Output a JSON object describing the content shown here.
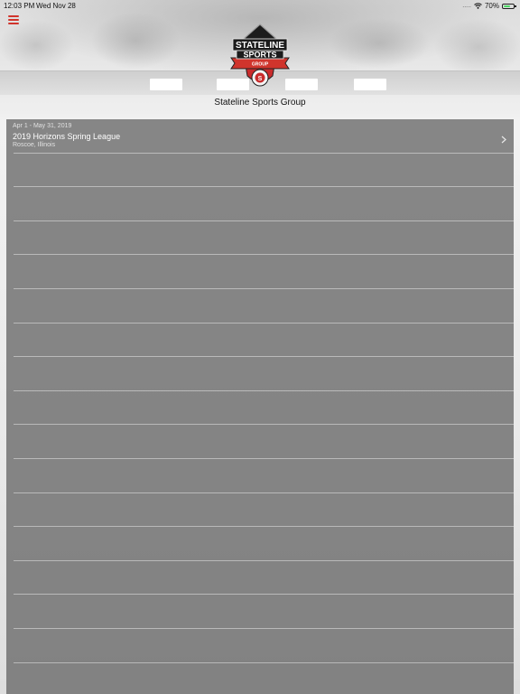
{
  "status_bar": {
    "time": "12:03 PM",
    "date": "Wed Nov 28",
    "signal": ".....",
    "battery_percent": "70%",
    "battery_level": 0.7
  },
  "header": {
    "menu_icon": "hamburger-menu-icon",
    "logo": {
      "line1": "STATELINE",
      "line2": "SPORTS",
      "line3": "GROUP"
    },
    "organization_name": "Stateline Sports Group"
  },
  "colors": {
    "accent": "#d0342c",
    "panel": "#6e6e6e"
  },
  "events": [
    {
      "date_range": "Apr 1 - May 31, 2019",
      "title": "2019 Horizons Spring League",
      "location": "Roscoe, Illinois",
      "icon": "chevron-right-icon"
    }
  ]
}
